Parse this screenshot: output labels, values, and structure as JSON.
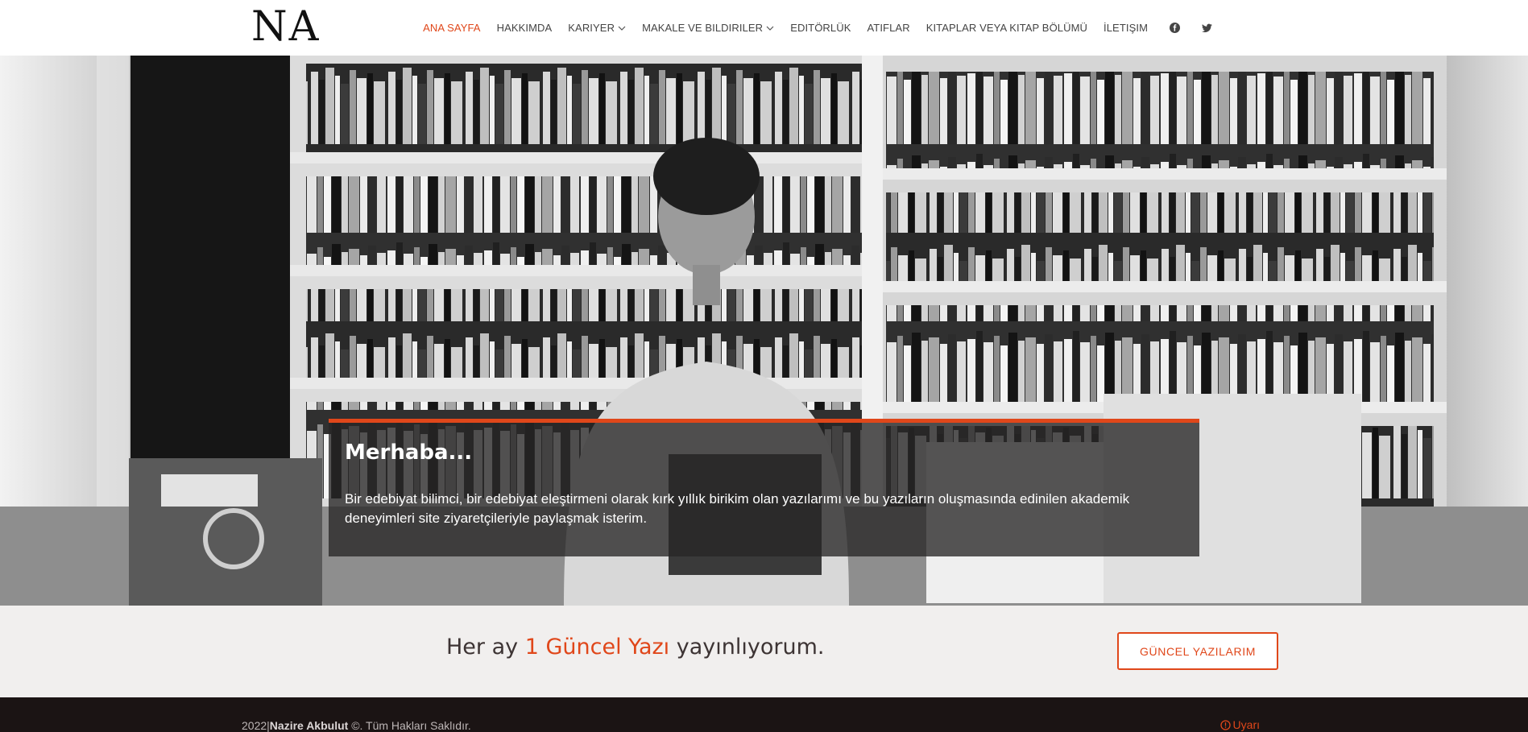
{
  "header": {
    "logo": "NA",
    "nav": [
      {
        "label": "ANA SAYFA"
      },
      {
        "label": "HAKKIMDA"
      },
      {
        "label": "KARIYER"
      },
      {
        "label": "MAKALE VE BILDIRILER"
      },
      {
        "label": "EDITÖRLÜK"
      },
      {
        "label": "ATIFLAR"
      },
      {
        "label": "KITAPLAR VEYA KITAP BÖLÜMÜ"
      },
      {
        "label": "İLETIŞIM"
      }
    ],
    "social": [
      "facebook-icon",
      "twitter-icon"
    ]
  },
  "hero": {
    "title": "Merhaba...",
    "text": "Bir edebiyat bilimci, bir edebiyat eleştirmeni olarak kırk yıllık birikim olan yazılarımı ve bu yazıların oluşmasında edinilen akademik deneyimleri site ziyaretçileriyle paylaşmak isterim."
  },
  "cta": {
    "text_before": "Her ay ",
    "highlight": "1 Güncel Yazı",
    "text_after": " yayınlıyorum.",
    "button": "GÜNCEL YAZILARIM"
  },
  "footer": {
    "year": "2022",
    "name": "Nazire Akbulut",
    "rights": "©. Tüm Hakları Saklıdır.",
    "warning": "Uyarı"
  },
  "colors": {
    "accent": "#e0471a",
    "footer_bg": "#1b1414",
    "cta_bg": "#f1efee"
  }
}
